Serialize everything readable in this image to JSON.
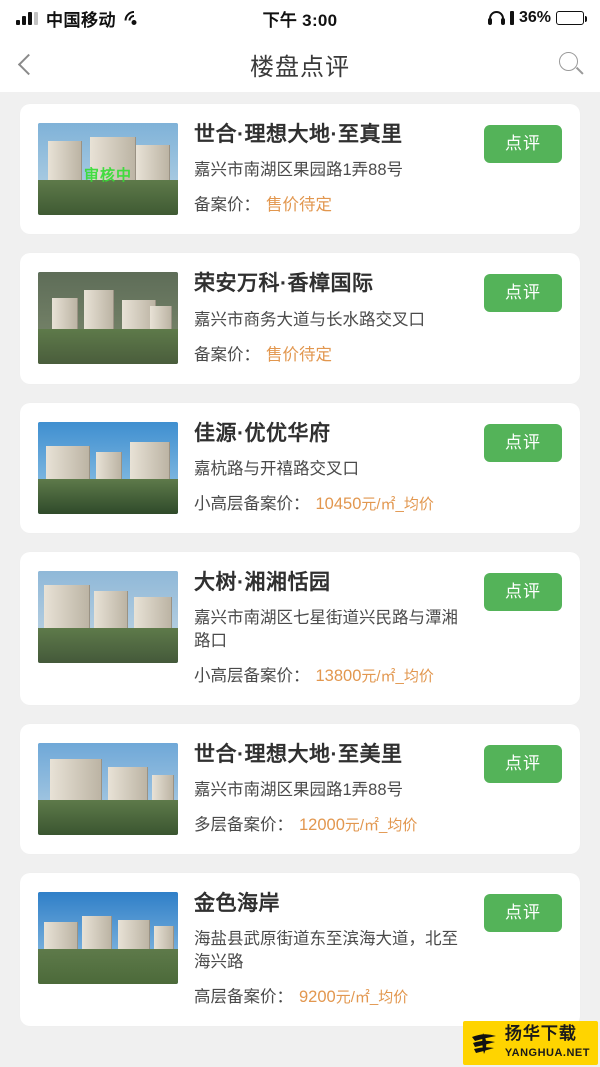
{
  "statusbar": {
    "carrier": "中国移动",
    "time": "下午 3:00",
    "battery_percent": "36%",
    "signal_icon": "signal-bars-icon",
    "wifi_icon": "wifi-icon",
    "headphone_icon": "headphone-icon",
    "battery_icon": "battery-icon"
  },
  "navbar": {
    "title": "楼盘点评",
    "back_icon": "chevron-left-icon",
    "search_icon": "search-icon"
  },
  "list": {
    "review_button_label": "点评",
    "thumb_overlay_label": "审核中",
    "items": [
      {
        "title": "世合·理想大地·至真里",
        "address": "嘉兴市南湖区果园路1弄88号",
        "price_label": "备案价：",
        "price_value": "售价待定",
        "price_unit": "",
        "has_overlay": true,
        "button": "点评"
      },
      {
        "title": "荣安万科·香樟国际",
        "address": "嘉兴市商务大道与长水路交叉口",
        "price_label": "备案价：",
        "price_value": "售价待定",
        "price_unit": "",
        "has_overlay": false,
        "button": "点评"
      },
      {
        "title": "佳源·优优华府",
        "address": "嘉杭路与开禧路交叉口",
        "price_label": "小高层备案价：",
        "price_value": "10450",
        "price_unit": "元/㎡_均价",
        "has_overlay": false,
        "button": "点评"
      },
      {
        "title": "大树·湘湘恬园",
        "address": "嘉兴市南湖区七星街道兴民路与潭湘路口",
        "price_label": "小高层备案价：",
        "price_value": "13800",
        "price_unit": "元/㎡_均价",
        "has_overlay": false,
        "button": "点评"
      },
      {
        "title": "世合·理想大地·至美里",
        "address": "嘉兴市南湖区果园路1弄88号",
        "price_label": "多层备案价：",
        "price_value": "12000",
        "price_unit": "元/㎡_均价",
        "has_overlay": false,
        "button": "点评"
      },
      {
        "title": "金色海岸",
        "address": "海盐县武原街道东至滨海大道，北至海兴路",
        "price_label": "高层备案价：",
        "price_value": "9200",
        "price_unit": "元/㎡_均价",
        "has_overlay": false,
        "button": "点评"
      }
    ]
  },
  "watermark": {
    "cn": "扬华下载",
    "en": "YANGHUA.NET",
    "logo_icon": "yanghua-logo-icon"
  },
  "colors": {
    "accent_green": "#54b359",
    "price_orange": "#e2974f",
    "page_bg": "#f0f0f0",
    "card_bg": "#ffffff",
    "watermark_yellow": "#ffd400"
  }
}
